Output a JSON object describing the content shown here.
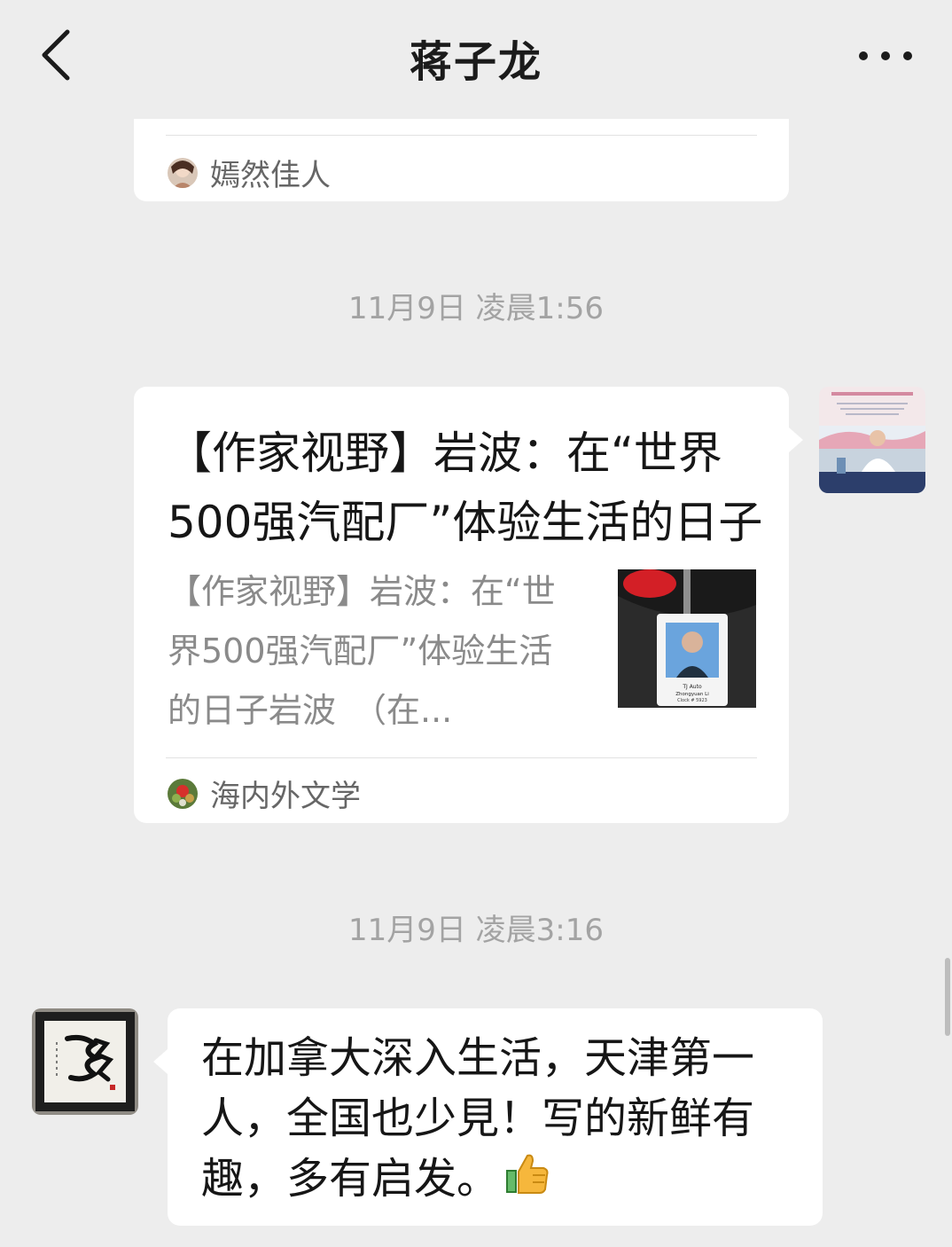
{
  "header": {
    "title": "蒋子龙"
  },
  "messages": [
    {
      "type": "article-partial",
      "source_name": "嫣然佳人"
    },
    {
      "type": "timestamp",
      "text": "11月9日 凌晨1:56"
    },
    {
      "type": "article",
      "title": "【作家视野】岩波：在“世界500强汽配厂”体验生活的日子",
      "desc": "【作家视野】岩波：在“世界500强汽配厂”体验生活的日子岩波　（在...",
      "thumb_badge": {
        "line1": "TJ Auto",
        "line2": "Zhongyuan Li",
        "line3": "Clock # 5923"
      },
      "source_name": "海内外文学"
    },
    {
      "type": "timestamp",
      "text": "11月9日 凌晨3:16"
    },
    {
      "type": "text",
      "text": "在加拿大深入生活，天津第一人，全国也少見！写的新鲜有趣，多有启发。",
      "emoji": "thumbs-up"
    }
  ],
  "colors": {
    "background": "#ededed",
    "bubble": "#ffffff",
    "timestamp": "#a3a3a3",
    "source_text": "#666666"
  }
}
